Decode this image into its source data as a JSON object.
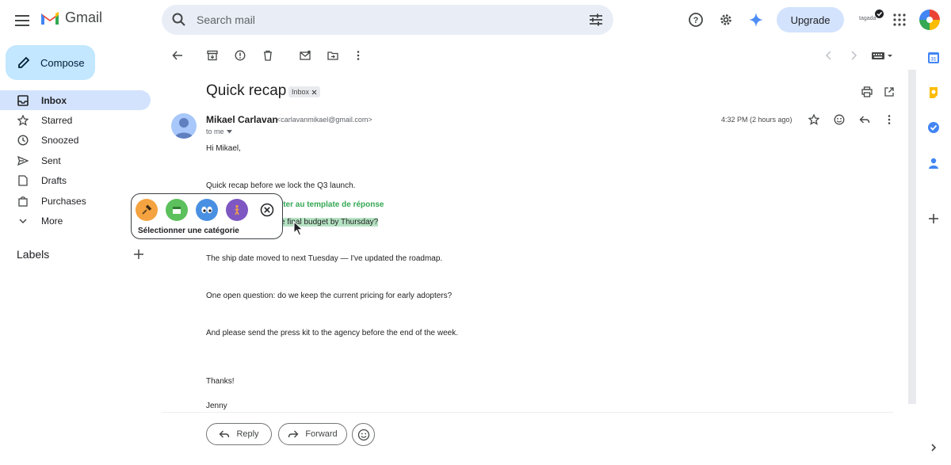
{
  "app": {
    "name": "Gmail"
  },
  "search": {
    "placeholder": "Search mail"
  },
  "header": {
    "upgrade_label": "Upgrade",
    "account_label": "tagada"
  },
  "compose": {
    "label": "Compose"
  },
  "sidebar": {
    "items": [
      {
        "label": "Inbox",
        "icon": "inbox-icon",
        "active": true
      },
      {
        "label": "Starred",
        "icon": "star-icon"
      },
      {
        "label": "Snoozed",
        "icon": "clock-icon"
      },
      {
        "label": "Sent",
        "icon": "send-icon"
      },
      {
        "label": "Drafts",
        "icon": "draft-icon"
      },
      {
        "label": "Purchases",
        "icon": "bag-icon"
      },
      {
        "label": "More",
        "icon": "chevron-down-icon"
      }
    ],
    "labels_title": "Labels"
  },
  "message": {
    "subject": "Quick recap",
    "badge": "Inbox",
    "sender_name": "Mikael Carlavan",
    "sender_email": "<carlavanmikael@gmail.com>",
    "to": "to me",
    "time": "4:32 PM (2 hours ago)",
    "greeting": "Hi Mikael,",
    "line1": "Quick recap before we lock the Q3 launch.",
    "template_action": "outer au template de réponse",
    "highlighted_line": "e final budget by Thursday?",
    "line3": "The ship date moved to next Tuesday — I've updated the roadmap.",
    "line4": "One open question: do we keep the current pricing for early adopters?",
    "line5": "And please send the press kit to the agency before the end of the week.",
    "thanks": "Thanks!",
    "signature": "Jenny"
  },
  "popup": {
    "label": "Sélectionner une catégorie",
    "categories": [
      {
        "icon": "hammer-icon",
        "color": "#f4a340"
      },
      {
        "icon": "calendar-icon",
        "color": "#5cc05c"
      },
      {
        "icon": "eyes-icon",
        "color": "#4a90e2"
      },
      {
        "icon": "person-icon",
        "color": "#7e57c2"
      }
    ]
  },
  "actions": {
    "reply_label": "Reply",
    "forward_label": "Forward"
  },
  "colors": {
    "accent": "#c2e7ff",
    "active_nav": "#d3e3fd",
    "highlight": "#b6e3c4",
    "template_green": "#34a853"
  }
}
